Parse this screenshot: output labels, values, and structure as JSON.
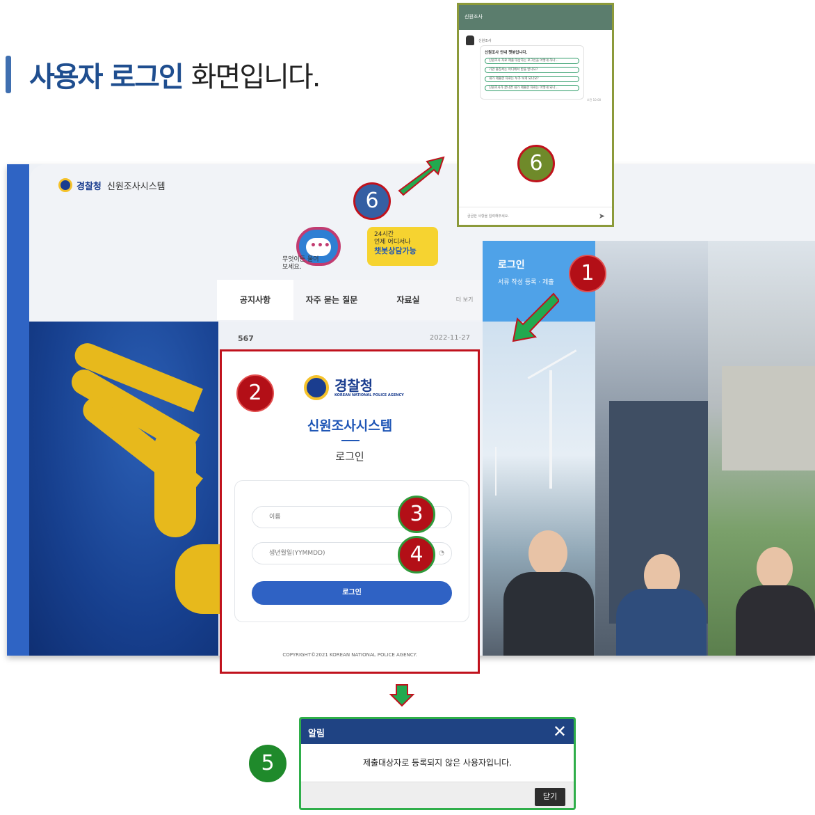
{
  "heading": {
    "bold": "사용자 로그인",
    "light": "화면입니다."
  },
  "brand": {
    "agency": "경찰청",
    "system": "신원조사시스템"
  },
  "chatbot": {
    "ask": "무엇이든 물어보세요.",
    "line1": "24시간",
    "line2": "언제 어디서나",
    "line3": "챗봇상담가능"
  },
  "tabs": [
    "공지사항",
    "자주 묻는 질문",
    "자료실"
  ],
  "more": "더 보기",
  "notice": {
    "number": "567",
    "date": "2022-11-27"
  },
  "login_tile": {
    "title": "로그인",
    "subtitle": "서류 작성 등록 · 제출"
  },
  "modal": {
    "agency": "경찰청",
    "agency_en": "KOREAN NATIONAL POLICE AGENCY",
    "title": "신원조사시스템",
    "subtitle": "로그인",
    "name_placeholder": "이름",
    "birth_placeholder": "생년월일(YYMMDD)",
    "login_button": "로그인",
    "copyright": "COPYRIGHT©2021 KOREAN NATIONAL POLICE AGENCY."
  },
  "chat_popup": {
    "header": "신원조사",
    "bot_name": "신원조사",
    "greeting": "신원조사 안내 챗봇입니다.",
    "chips": [
      "신원조사 자료 제출 대상자는 로그인을 어떻게 하나...",
      "기관 출장서는 어디에서 받을 받나요?",
      "내가 제출한 자료는 누가 보게 되나요?",
      "신원조사가 끝나면 내가 제출한 자료는 어떻게 되나..."
    ],
    "time": "오전 10:00",
    "input_placeholder": "궁금한 사항을 입력해주세요."
  },
  "badges": {
    "b1": "1",
    "b2": "2",
    "b3": "3",
    "b4": "4",
    "b5": "5",
    "b6": "6"
  },
  "alert": {
    "title": "알림",
    "message": "제출대상자로 등록되지 않은 사용자입니다.",
    "close": "닫기"
  }
}
